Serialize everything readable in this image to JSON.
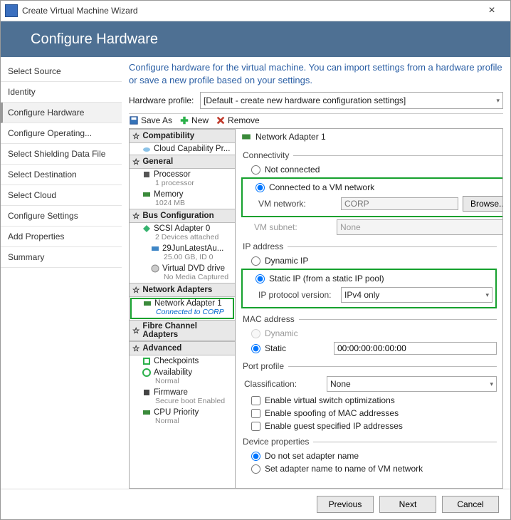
{
  "window": {
    "title": "Create Virtual Machine Wizard"
  },
  "banner": {
    "title": "Configure Hardware"
  },
  "nav": {
    "items": [
      "Select Source",
      "Identity",
      "Configure Hardware",
      "Configure Operating...",
      "Select Shielding Data File",
      "Select Destination",
      "Select Cloud",
      "Configure Settings",
      "Add Properties",
      "Summary"
    ],
    "selected_index": 2
  },
  "intro": "Configure hardware for the virtual machine. You can import settings from a hardware profile or save a new profile based on your settings.",
  "hw_profile": {
    "label": "Hardware profile:",
    "value": "[Default - create new hardware configuration settings]"
  },
  "toolbar": {
    "save_as": "Save As",
    "new": "New",
    "remove": "Remove"
  },
  "tree": {
    "g_compat": "Compatibility",
    "cloud_cap": "Cloud Capability Pr...",
    "g_general": "General",
    "processor": "Processor",
    "processor_sub": "1 processor",
    "memory": "Memory",
    "memory_sub": "1024 MB",
    "g_bus": "Bus Configuration",
    "scsi": "SCSI Adapter 0",
    "scsi_sub": "2 Devices attached",
    "disk": "29JunLatestAu...",
    "disk_sub": "25.00 GB, ID 0",
    "dvd": "Virtual DVD drive",
    "dvd_sub": "No Media Captured",
    "g_net": "Network Adapters",
    "nic": "Network Adapter 1",
    "nic_sub": "Connected to CORP",
    "g_fc": "Fibre Channel Adapters",
    "g_adv": "Advanced",
    "chk": "Checkpoints",
    "avail": "Availability",
    "avail_sub": "Normal",
    "fw": "Firmware",
    "fw_sub": "Secure boot Enabled",
    "cpu": "CPU Priority",
    "cpu_sub": "Normal"
  },
  "props": {
    "header": "Network Adapter 1",
    "conn": {
      "legend": "Connectivity",
      "not_connected": "Not connected",
      "connected": "Connected to a VM network",
      "vm_network_label": "VM network:",
      "vm_network_value": "CORP",
      "browse": "Browse...",
      "vm_subnet_label": "VM subnet:",
      "vm_subnet_value": "None"
    },
    "ip": {
      "legend": "IP address",
      "dynamic": "Dynamic IP",
      "static": "Static IP (from a static IP pool)",
      "proto_label": "IP protocol version:",
      "proto_value": "IPv4 only"
    },
    "mac": {
      "legend": "MAC address",
      "dynamic": "Dynamic",
      "static": "Static",
      "value": "00:00:00:00:00:00"
    },
    "port": {
      "legend": "Port profile",
      "class_label": "Classification:",
      "class_value": "None",
      "opt1": "Enable virtual switch optimizations",
      "opt2": "Enable spoofing of MAC addresses",
      "opt3": "Enable guest specified IP addresses"
    },
    "dev": {
      "legend": "Device properties",
      "r1": "Do not set adapter name",
      "r2": "Set adapter name to name of VM network"
    }
  },
  "footer": {
    "prev": "Previous",
    "next": "Next",
    "cancel": "Cancel"
  }
}
